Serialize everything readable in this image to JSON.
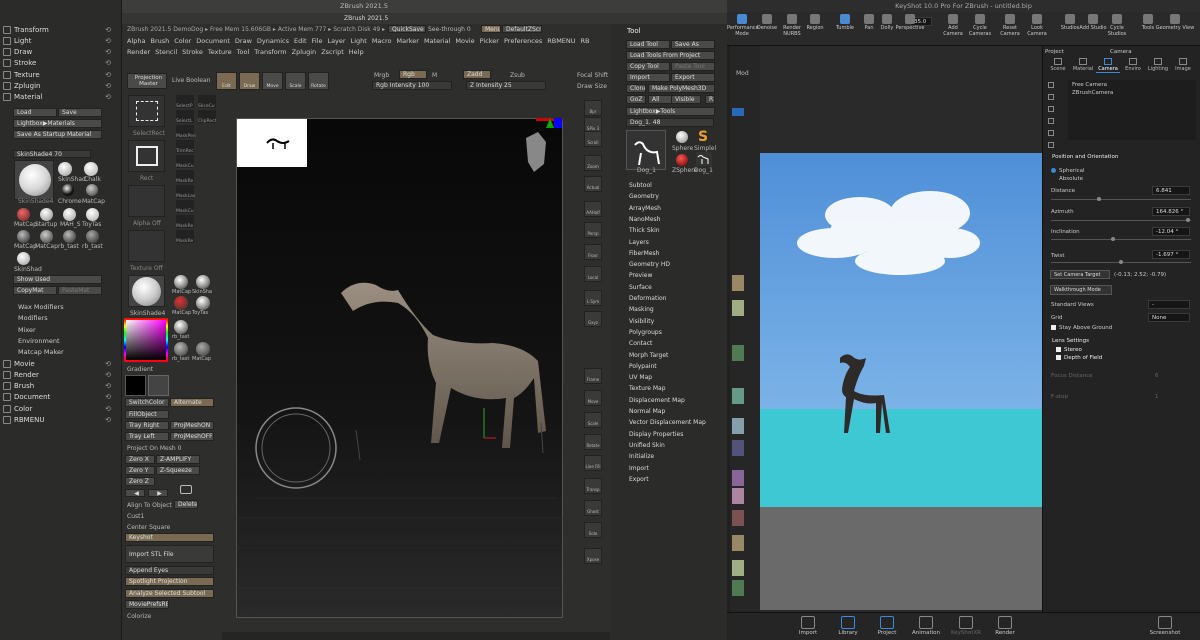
{
  "zbrush": {
    "title": "ZBrush 2021.5",
    "subtitle": "ZBrush 2021.5",
    "infobar": "ZBrush 2021.5  DemoDog  ▸ Free Mem 15.606GB ▸ Active Mem 777 ▸ Scratch Disk 49 ▸",
    "quicksave": "QuickSave",
    "see_through": "See-through  0",
    "menus_btn": "Menus",
    "default_zscript": "DefaultZScript",
    "menu_row1": [
      "Alpha",
      "Brush",
      "Color",
      "Document",
      "Draw",
      "Dynamics",
      "Edit",
      "File",
      "Layer",
      "Light",
      "Macro",
      "Marker",
      "Material",
      "Movie",
      "Picker",
      "Preferences",
      "RBMENU",
      "RB"
    ],
    "menu_row2": [
      "Render",
      "Stencil",
      "Stroke",
      "Texture",
      "Tool",
      "Transform",
      "Zplugin",
      "Zscript",
      "Help"
    ],
    "left_menu": [
      "Transform",
      "Light",
      "Draw",
      "Stroke",
      "Texture",
      "Zplugin",
      "Material"
    ],
    "left_menu_bottom": [
      "Movie",
      "Render",
      "Brush",
      "Document",
      "Color",
      "RBMENU"
    ],
    "material_buttons": [
      "Load",
      "Save",
      "Lightbox▶Materials",
      "Save As Startup Material"
    ],
    "skinshade_label": "SkinShade4",
    "skinshade_value": "70",
    "mat_labels": [
      "SkinShad",
      "Chalk",
      "SkinShade4",
      "Chrome",
      "MatCap",
      "MatCap",
      "Startup",
      "MAH_S",
      "ToyTas",
      "MatCap",
      "MatCap",
      "rb_tast",
      "rb_tast",
      "SkinShad"
    ],
    "show_used": "Show Used",
    "copymat": "CopyMat",
    "pastemat": "PasteMat",
    "mat_sub": [
      "Wax Modifiers",
      "Modifiers",
      "Mixer",
      "Environment",
      "Matcap Maker"
    ],
    "projection_master": "Projection Master",
    "live_boolean": "Live Boolean",
    "top_tools": [
      "Edit",
      "Draw",
      "Move",
      "Scale",
      "Rotate"
    ],
    "mrgb": "Mrgb",
    "rgb": "Rgb",
    "m": "M",
    "zadd": "Zadd",
    "zsub": "Zsub",
    "rgb_intensity": "Rgb Intensity 100",
    "z_intensity": "Z Intensity 25",
    "focal_shift": "Focal Shift",
    "draw_size": "Draw Size",
    "col2_labels": [
      "SelectRect",
      "SelectP",
      "SliceCu",
      "SelectL",
      "ClipRect",
      "MaskPen",
      "TrimRec",
      "MaskCu",
      "MaskRe",
      "MaskLas",
      "MaskCu",
      "MaskRe",
      "MaskRe"
    ],
    "rect": "Rect",
    "alpha_off": "Alpha Off",
    "texture_off": "Texture Off",
    "col2_mats": [
      "MatCap",
      "SkinSha",
      "SkinShade4",
      "MatCap",
      "ToyTas",
      "rb_tast",
      "rb_tast",
      "MatCap"
    ],
    "gradient": "Gradient",
    "switchcolor": "SwitchColor",
    "alternate": "Alternate",
    "fillobject": "FillObject",
    "tray_right": "Tray Right",
    "projmeshon": "ProjMeshON",
    "tray_left": "Tray Left",
    "projmeshoff": "ProjMeshOFF",
    "project_on_mesh": "Project On Mesh  0",
    "zero_x": "Zero X",
    "z_amplify": "Z-AMPLIFY",
    "zero_y": "Zero Y",
    "z_squeeze": "Z-Squeeze",
    "zero_z": "Zero Z",
    "align_to_object": "Align To Object",
    "delete": "Delete",
    "cust1": "Cust1",
    "center_square": "Center  Square",
    "rb_list": [
      "Keyshot",
      "Import STL File",
      "Append Eyes",
      "Spotlight Projection",
      "Analyze Selected Subtool",
      "MoviePrefsRB",
      "Colorize"
    ],
    "right_tools": [
      "Bpr",
      "SPix 3",
      "Scroll",
      "Zoom",
      "Actual",
      "AAHalf",
      "Persp",
      "Floor",
      "Local",
      "L.Sym",
      "Gxyz",
      "Frame",
      "Move",
      "Scale",
      "Rotate",
      "Line Fill",
      "Transp",
      "Ghost",
      "Solo",
      "Xpose"
    ],
    "tool_title": "Tool",
    "tool_buttons": [
      "Load Tool",
      "Save As",
      "Load Tools From Project",
      "Copy Tool",
      "Paste Tool",
      "Import",
      "Export",
      "Clone",
      "Make PolyMesh3D",
      "GoZ",
      "All",
      "Visible",
      "R",
      "Lightbox▶Tools"
    ],
    "dog_label": "Dog_1.",
    "dog_value": "48",
    "tool_thumbs": [
      "Dog_1",
      "Sphere",
      "Simplel",
      "ZSphere",
      "Dog_1"
    ],
    "tool_list": [
      "Subtool",
      "Geometry",
      "ArrayMesh",
      "NanoMesh",
      "Thick Skin",
      "Layers",
      "FiberMesh",
      "Geometry HD",
      "Preview",
      "Surface",
      "Deformation",
      "Masking",
      "Visibility",
      "Polygroups",
      "Contact",
      "Morph Target",
      "Polypaint",
      "UV Map",
      "Texture Map",
      "Displacement Map",
      "Normal Map",
      "Vector Displacement Map",
      "Display Properties",
      "Unified Skin",
      "Initialize",
      "Import",
      "Export"
    ]
  },
  "keyshot": {
    "title": "KeyShot 10.0 Pro For ZBrush - untitled.bip",
    "toolbar": [
      "Performance Mode",
      "Denoise",
      "Render NURBS",
      "Region",
      "Tumble",
      "Pan",
      "Dolly",
      "Perspective",
      "Add Camera",
      "Cycle Cameras",
      "Reset Camera",
      "Look Camera",
      "Studios",
      "Add Studio",
      "Cycle Studios",
      "Tools",
      "Geometry View"
    ],
    "fov_value": "35.0",
    "lib_tab": "Mod",
    "bottom": [
      "Import",
      "Library",
      "Project",
      "Animation",
      "KeyShotXR",
      "Render",
      "Screenshot"
    ],
    "panel_tabs": [
      "Project",
      "Camera"
    ],
    "subtabs": [
      "Scene",
      "Material",
      "Camera",
      "Enviro",
      "Lighting",
      "Image"
    ],
    "cameras": [
      "Free Camera",
      "ZBrushCamera"
    ],
    "section_position": "Position and Orientation",
    "spherical": "Spherical",
    "absolute": "Absolute",
    "distance_label": "Distance",
    "distance": "6.841",
    "azimuth_label": "Azimuth",
    "azimuth": "164.826 °",
    "inclination_label": "Inclination",
    "inclination": "-12.04 °",
    "twist_label": "Twist",
    "twist": "-1.697 °",
    "set_camera_target": "Set Camera Target",
    "camera_target_value": "(-0.13; 2.52; -0.79)",
    "walkthrough": "Walkthrough Mode",
    "standard_views_label": "Standard Views",
    "standard_views": "-",
    "grid_label": "Grid",
    "grid": "None",
    "stay_above": "Stay Above Ground",
    "lens_settings": "Lens Settings",
    "stereo": "Stereo",
    "dof": "Depth of Field",
    "focus_distance_label": "Focus Distance",
    "focus_distance": "6",
    "fstop_label": "F-stop",
    "fstop": "1"
  }
}
